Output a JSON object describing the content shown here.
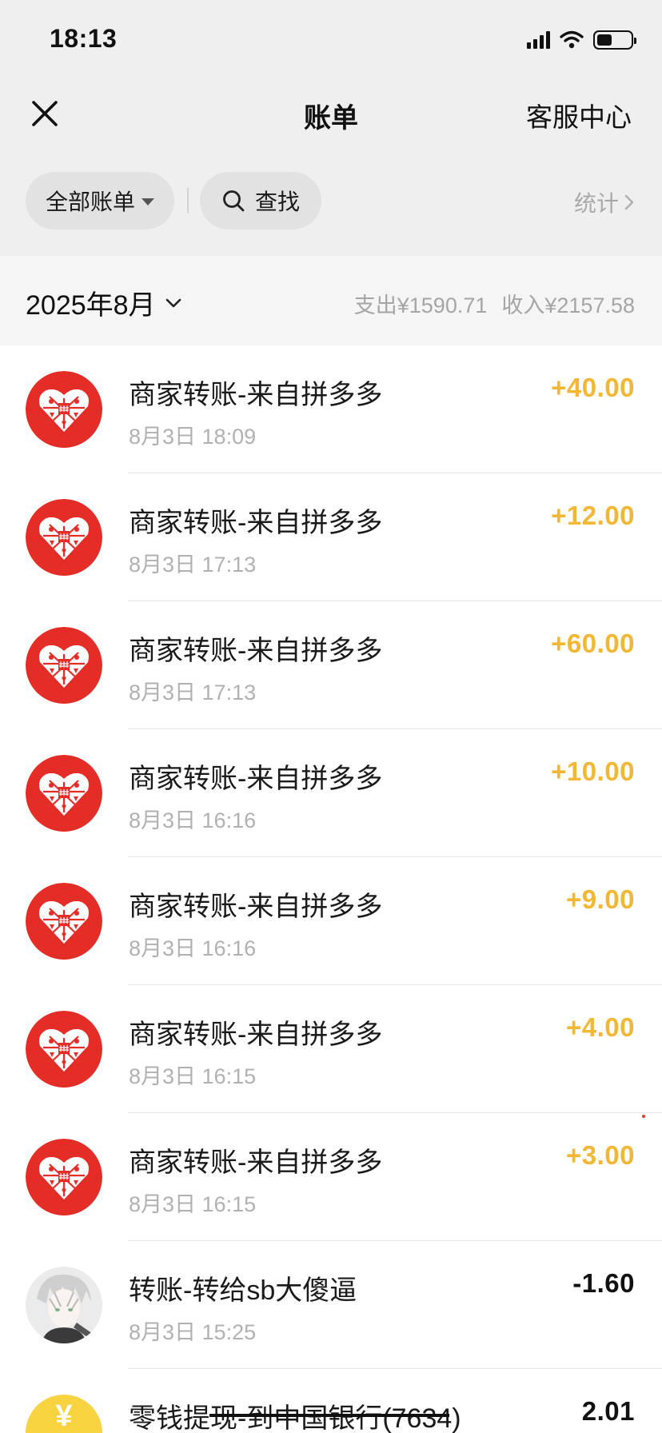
{
  "status_bar": {
    "time": "18:13"
  },
  "nav": {
    "title": "账单",
    "right_label": "客服中心"
  },
  "filters": {
    "all_bills_label": "全部账单",
    "search_label": "查找",
    "stats_label": "统计"
  },
  "month": {
    "label": "2025年8月",
    "expense": "支出¥1590.71",
    "income": "收入¥2157.58"
  },
  "transactions": [
    {
      "title": "商家转账-来自拼多多",
      "time": "8月3日 18:09",
      "amount": "+40.00",
      "icon": "pinduoduo-logo-icon"
    },
    {
      "title": "商家转账-来自拼多多",
      "time": "8月3日 17:13",
      "amount": "+12.00",
      "icon": "pinduoduo-logo-icon"
    },
    {
      "title": "商家转账-来自拼多多",
      "time": "8月3日 17:13",
      "amount": "+60.00",
      "icon": "pinduoduo-logo-icon"
    },
    {
      "title": "商家转账-来自拼多多",
      "time": "8月3日 16:16",
      "amount": "+10.00",
      "icon": "pinduoduo-logo-icon"
    },
    {
      "title": "商家转账-来自拼多多",
      "time": "8月3日 16:16",
      "amount": "+9.00",
      "icon": "pinduoduo-logo-icon"
    },
    {
      "title": "商家转账-来自拼多多",
      "time": "8月3日 16:15",
      "amount": "+4.00",
      "icon": "pinduoduo-logo-icon"
    },
    {
      "title": "商家转账-来自拼多多",
      "time": "8月3日 16:15",
      "amount": "+3.00",
      "icon": "pinduoduo-logo-icon"
    },
    {
      "title": "转账-转给sb大傻逼",
      "time": "8月3日 15:25",
      "amount": "-1.60",
      "icon": "user-avatar-icon"
    },
    {
      "title": "零钱提现-到中国银行(7634)",
      "time": "",
      "amount": "2.01",
      "icon": "yuan-coin-icon"
    }
  ],
  "colors": {
    "income": "#f2b735",
    "expense": "#111111",
    "pinduoduo_red": "#e52d27",
    "coin_yellow": "#f6d33f"
  }
}
